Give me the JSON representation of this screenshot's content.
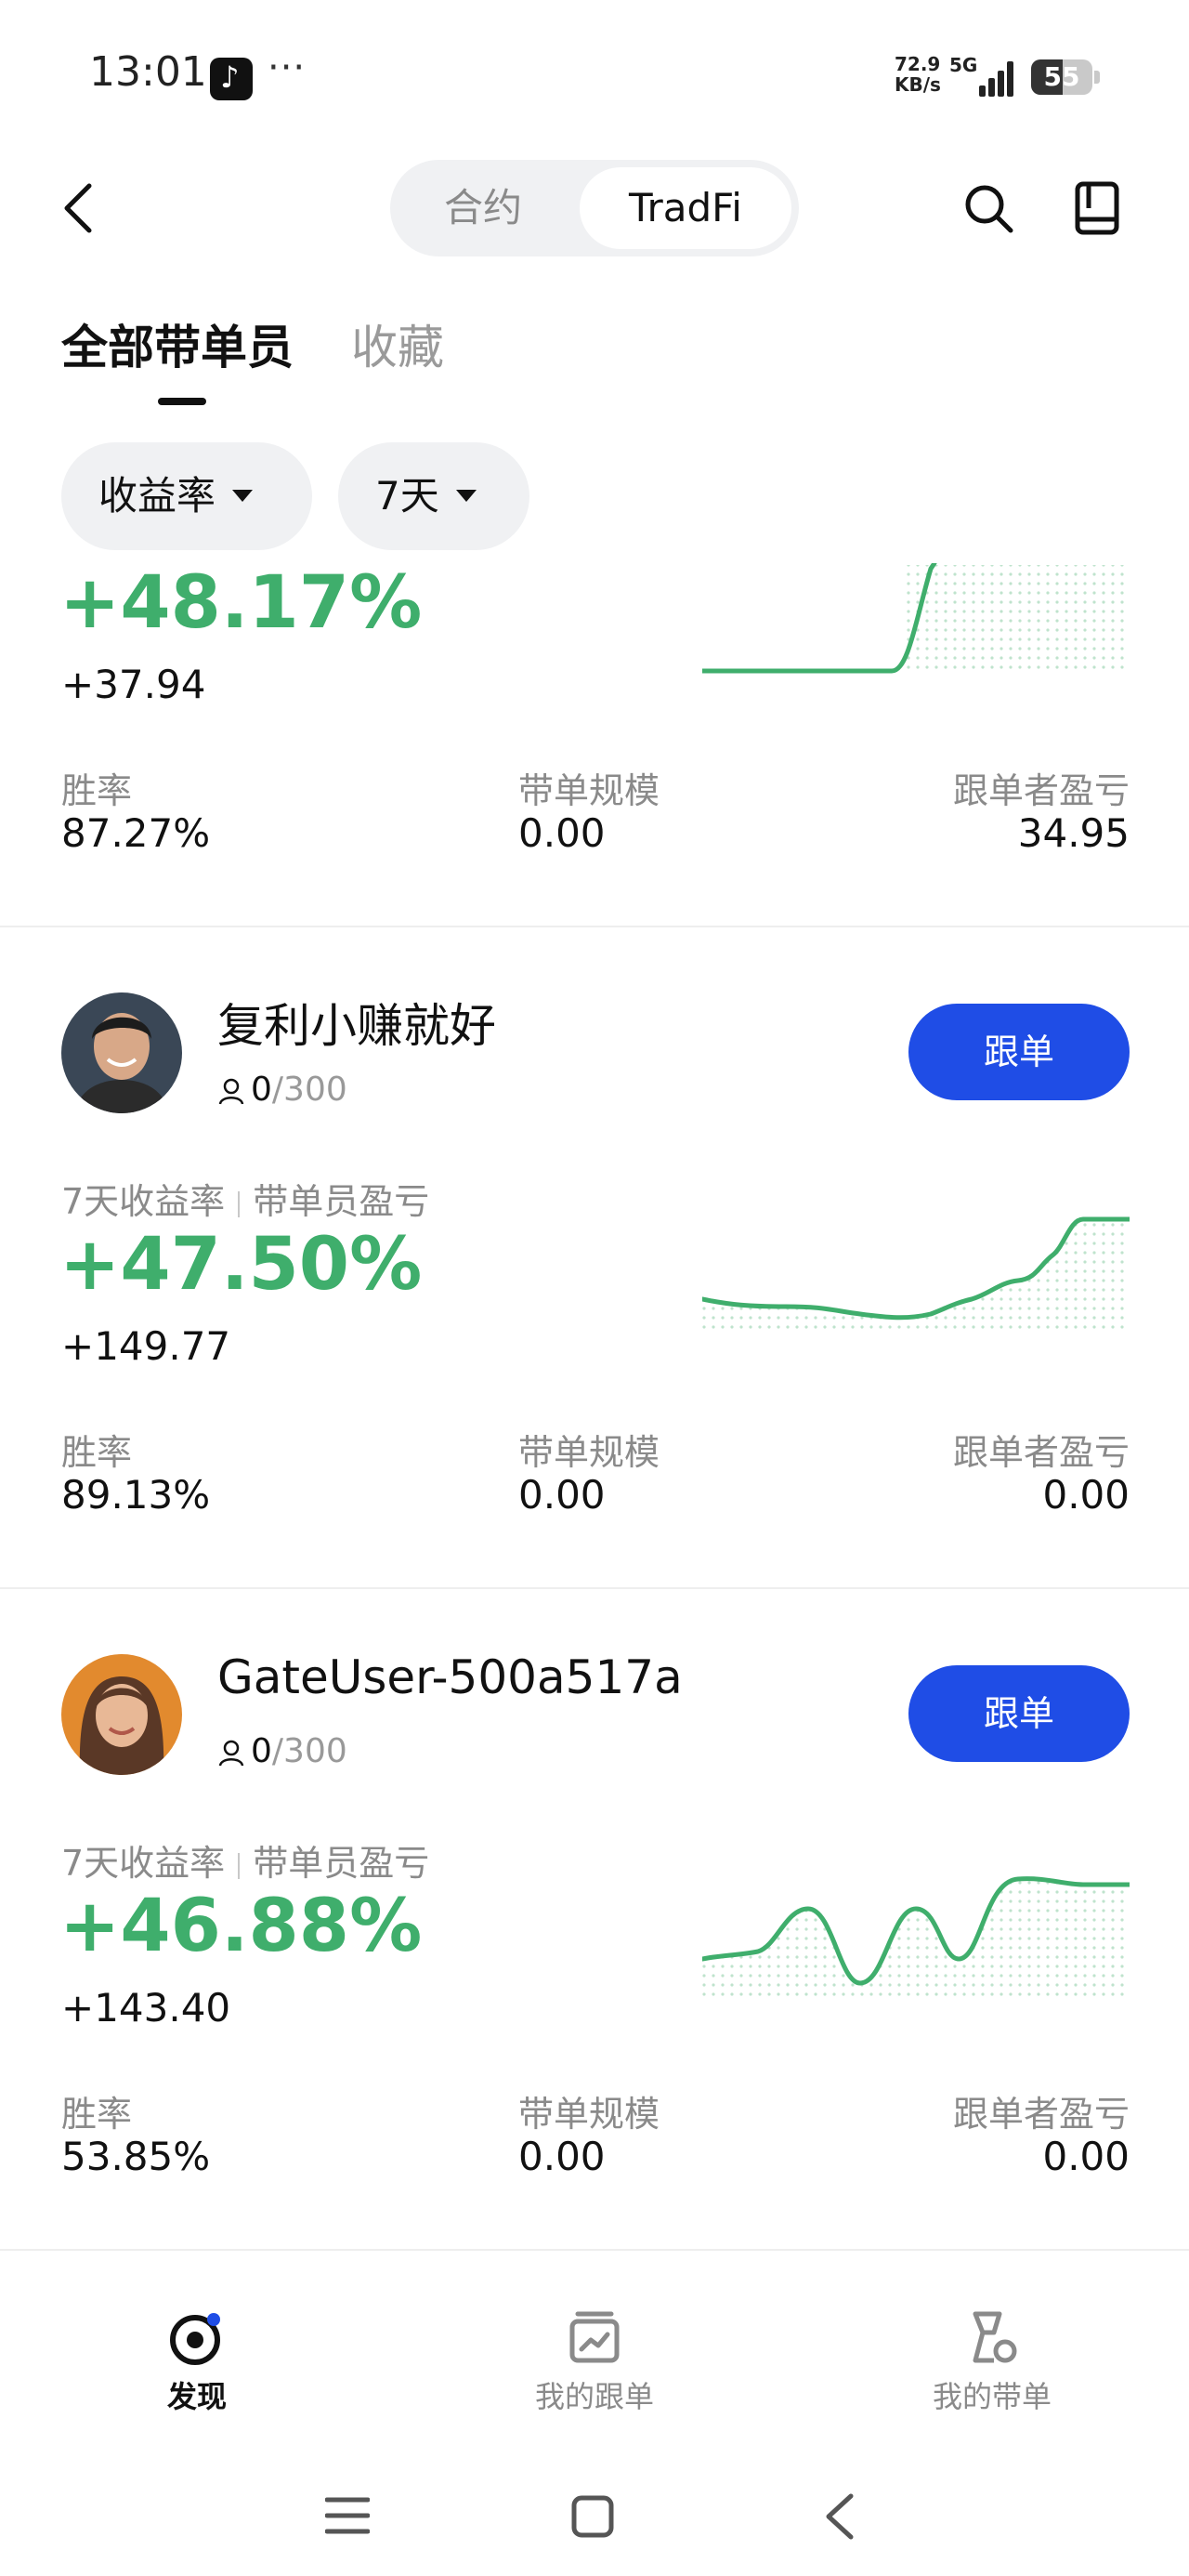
{
  "status_bar": {
    "time": "13:01",
    "dots": "···",
    "net_speed_top": "72.9",
    "net_speed_bottom": "KB/s",
    "network": "5G",
    "battery": "55"
  },
  "header": {
    "segments": [
      "合约",
      "TradFi"
    ],
    "active_segment": "TradFi",
    "icons": [
      "back-icon",
      "search-icon",
      "book-icon"
    ]
  },
  "tabs": [
    "全部带单员",
    "收藏"
  ],
  "filters": [
    "收益率",
    "7天"
  ],
  "cards": [
    {
      "return_pct": "+48.17%",
      "pnl": "+37.94",
      "stats": [
        {
          "label": "胜率",
          "value": "87.27%"
        },
        {
          "label": "带单规模",
          "value": "0.00"
        },
        {
          "label": "跟单者盈亏",
          "value": "34.95"
        }
      ]
    },
    {
      "name": "复利小赚就好",
      "followers": "0",
      "followers_max": "/300",
      "follow_label": "跟单",
      "sub_label_1": "7天收益率",
      "sub_label_2": "带单员盈亏",
      "return_pct": "+47.50%",
      "pnl": "+149.77",
      "stats": [
        {
          "label": "胜率",
          "value": "89.13%"
        },
        {
          "label": "带单规模",
          "value": "0.00"
        },
        {
          "label": "跟单者盈亏",
          "value": "0.00"
        }
      ]
    },
    {
      "name": "GateUser-500a517a",
      "followers": "0",
      "followers_max": "/300",
      "follow_label": "跟单",
      "sub_label_1": "7天收益率",
      "sub_label_2": "带单员盈亏",
      "return_pct": "+46.88%",
      "pnl": "+143.40",
      "stats": [
        {
          "label": "胜率",
          "value": "53.85%"
        },
        {
          "label": "带单规模",
          "value": "0.00"
        },
        {
          "label": "跟单者盈亏",
          "value": "0.00"
        }
      ]
    }
  ],
  "bottom_nav": [
    {
      "label": "发现",
      "icon": "discover-icon",
      "active": true
    },
    {
      "label": "我的跟单",
      "icon": "my-copy-icon",
      "active": false
    },
    {
      "label": "我的带单",
      "icon": "my-lead-icon",
      "active": false
    }
  ],
  "colors": {
    "accent_green": "#3fae6c",
    "button_blue": "#1f4de6"
  }
}
